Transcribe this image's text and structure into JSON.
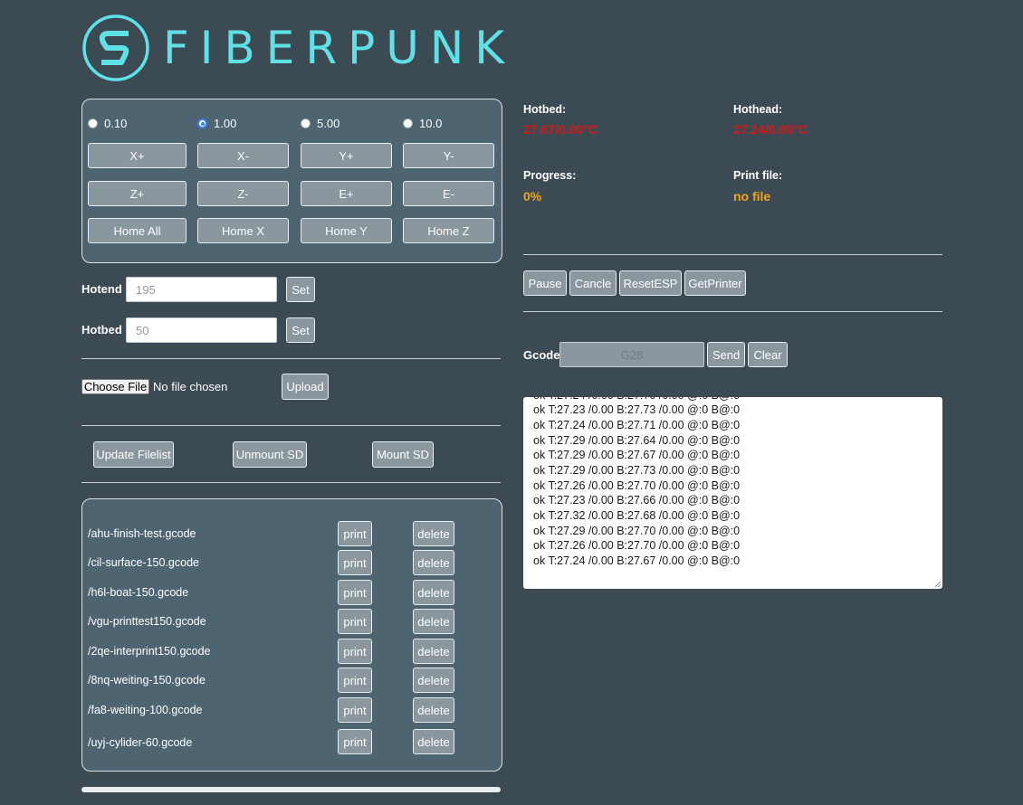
{
  "brand": {
    "name": "FIBERPUNK",
    "accent": "#5fe1e6"
  },
  "jog": {
    "steps": [
      {
        "label": "0.10",
        "checked": false
      },
      {
        "label": "1.00",
        "checked": true
      },
      {
        "label": "5.00",
        "checked": false
      },
      {
        "label": "10.0",
        "checked": false
      }
    ],
    "buttons": [
      [
        "X+",
        "X-",
        "Y+",
        "Y-"
      ],
      [
        "Z+",
        "Z-",
        "E+",
        "E-"
      ],
      [
        "Home All",
        "Home X",
        "Home Y",
        "Home Z"
      ]
    ]
  },
  "temps": {
    "hotend_label": "Hotend",
    "hotend_placeholder": "195",
    "hotbed_label": "Hotbed",
    "hotbed_placeholder": "50",
    "set_label": "Set"
  },
  "upload": {
    "choose_label": "Choose File",
    "no_file_text": "No file chosen",
    "upload_label": "Upload"
  },
  "sd": {
    "update_label": "Update Filelist",
    "unmount_label": "Unmount SD",
    "mount_label": "Mount SD"
  },
  "files": {
    "print_label": "print",
    "delete_label": "delete",
    "items": [
      "/ahu-finish-test.gcode",
      "/cil-surface-150.gcode",
      "/h6l-boat-150.gcode",
      "/vgu-printtest150.gcode",
      "/2qe-interprint150.gcode",
      "/8nq-weiting-150.gcode",
      "/fa8-weiting-100.gcode",
      "/uyj-cylider-60.gcode"
    ]
  },
  "status": {
    "hotbed_label": "Hotbed:",
    "hotbed_value": "27.67/0.00°C",
    "hothead_label": "Hothead:",
    "hothead_value": "27.24/0.00°C",
    "progress_label": "Progress:",
    "progress_value": "0%",
    "printfile_label": "Print file:",
    "printfile_value": "no file"
  },
  "controls": {
    "pause": "Pause",
    "cancel": "Cancle",
    "reset": "ResetESP",
    "getprinter": "GetPrinter"
  },
  "gcode": {
    "label": "Gcode",
    "placeholder": "G28",
    "send": "Send",
    "clear": "Clear"
  },
  "console": {
    "lines": [
      "ok T:27.23 /0.00 B:27.73 /0.00 @:0 B@:0",
      "ok T:27.24 /0.00 B:27.71 /0.00 @:0 B@:0",
      "ok T:27.29 /0.00 B:27.64 /0.00 @:0 B@:0",
      "ok T:27.29 /0.00 B:27.67 /0.00 @:0 B@:0",
      "ok T:27.29 /0.00 B:27.73 /0.00 @:0 B@:0",
      "ok T:27.26 /0.00 B:27.70 /0.00 @:0 B@:0",
      "ok T:27.23 /0.00 B:27.66 /0.00 @:0 B@:0",
      "ok T:27.32 /0.00 B:27.68 /0.00 @:0 B@:0",
      "ok T:27.29 /0.00 B:27.70 /0.00 @:0 B@:0",
      "ok T:27.26 /0.00 B:27.70 /0.00 @:0 B@:0",
      "ok T:27.24 /0.00 B:27.67 /0.00 @:0 B@:0"
    ]
  }
}
